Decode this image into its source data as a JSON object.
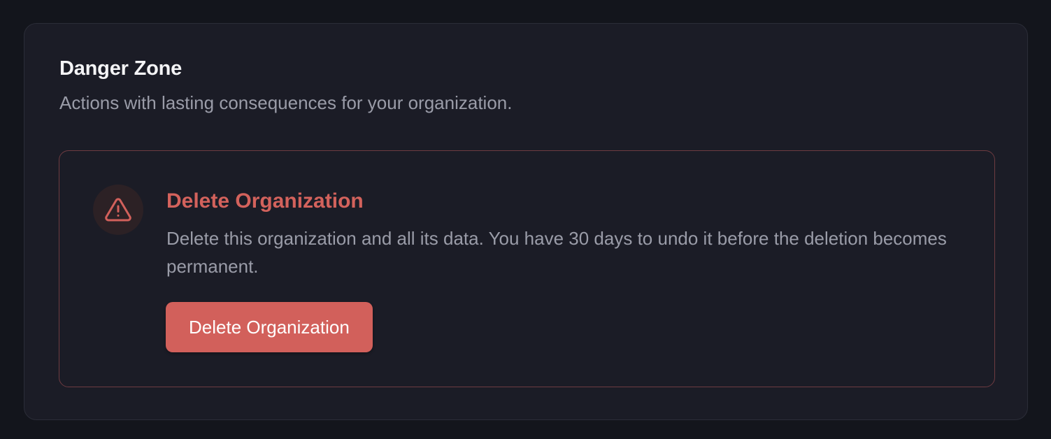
{
  "section": {
    "title": "Danger Zone",
    "subtitle": "Actions with lasting consequences for your organization."
  },
  "delete_org": {
    "icon": "warning-triangle-icon",
    "title": "Delete Organization",
    "description": "Delete this organization and all its data. You have 30 days to undo it before the deletion becomes permanent.",
    "button_label": "Delete Organization"
  },
  "colors": {
    "background": "#13151c",
    "card": "#1b1c26",
    "danger_accent": "#d2605b",
    "danger_border": "#6e3b41",
    "muted_text": "#9a9ca8"
  }
}
